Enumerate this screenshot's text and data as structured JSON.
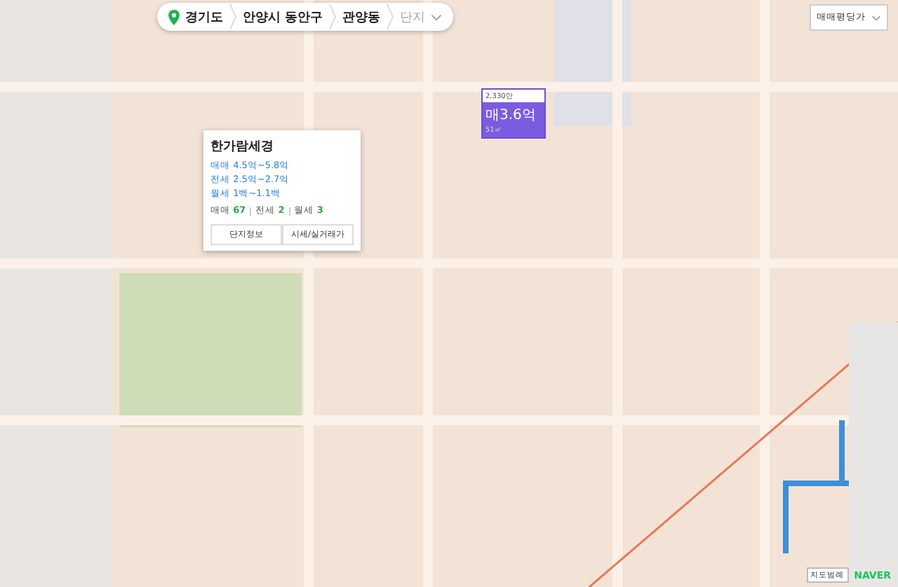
{
  "breadcrumb": {
    "items": [
      {
        "label": "경기도",
        "kind": "region"
      },
      {
        "label": "안양시 동안구",
        "kind": "region"
      },
      {
        "label": "관양동",
        "kind": "region"
      },
      {
        "label": "단지",
        "kind": "placeholder"
      }
    ]
  },
  "price_marker": {
    "unit_price": "2,330만",
    "price": "매3.6억",
    "area": "51㎡"
  },
  "popup": {
    "title": "한가람세경",
    "lines": [
      {
        "label": "매매 4.5억~5.8억"
      },
      {
        "label": "전세 2.5억~2.7억"
      },
      {
        "label": "월세 1백~1.1백"
      }
    ],
    "counts": [
      {
        "label": "매매",
        "count": "67"
      },
      {
        "label": "전세",
        "count": "2"
      },
      {
        "label": "월세",
        "count": "3"
      }
    ],
    "buttons": [
      "단지정보",
      "시세/실거래가"
    ]
  },
  "price_filter": {
    "value": "매매평당가"
  },
  "legend_button": "지도범례",
  "logo": "NAVER"
}
